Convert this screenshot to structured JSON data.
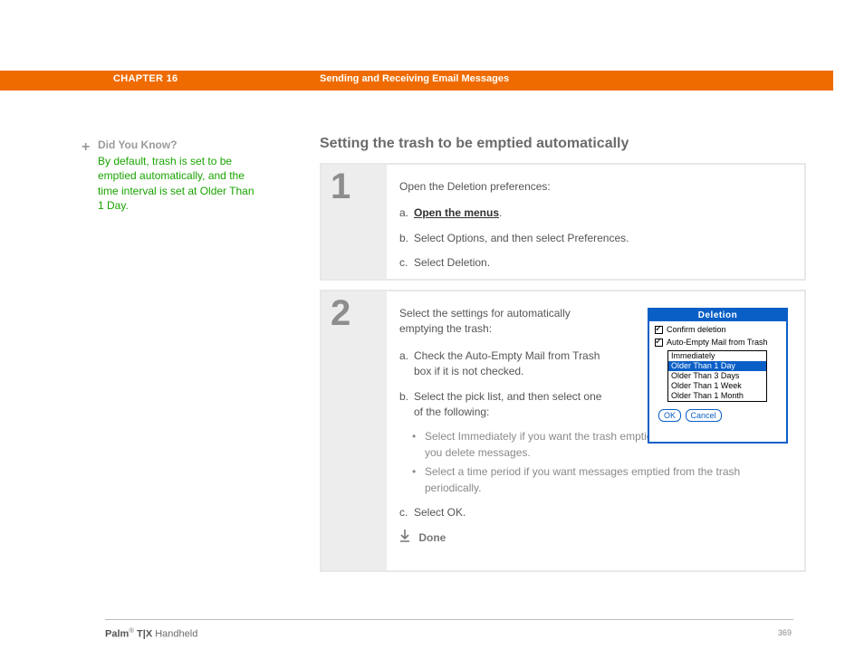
{
  "header": {
    "chapter": "CHAPTER 16",
    "banner": "Sending and Receiving Email Messages"
  },
  "sidebar": {
    "dyk_heading": "Did You Know?",
    "dyk_body": "By default, trash is set to be emptied automatically, and the time interval is set at Older Than 1 Day."
  },
  "section_title": "Setting the trash to be emptied automatically",
  "step1": {
    "num": "1",
    "intro": "Open the Deletion preferences:",
    "a_label": "a.",
    "a_text": "Open the menus",
    "a_suffix": ".",
    "b_label": "b.",
    "b_text": "Select Options, and then select Preferences.",
    "c_label": "c.",
    "c_text": "Select Deletion."
  },
  "step2": {
    "num": "2",
    "intro": "Select the settings for automatically emptying the trash:",
    "a_label": "a.",
    "a_text": "Check the Auto-Empty Mail from Trash box if it is not checked.",
    "b_label": "b.",
    "b_text": "Select the pick list, and then select one of the following:",
    "bullet1": "Select Immediately if you want the trash emptied automatically each time you delete messages.",
    "bullet2": "Select a time period if you want messages emptied from the trash periodically.",
    "c_label": "c.",
    "c_text": "Select OK.",
    "done": "Done"
  },
  "palm": {
    "title": "Deletion",
    "chk1": "Confirm deletion",
    "chk2": "Auto-Empty Mail from Trash",
    "options": [
      "Immediately",
      "Older Than 1 Day",
      "Older Than 3 Days",
      "Older Than 1 Week",
      "Older Than 1 Month"
    ],
    "selected_index": 1,
    "ok": "OK",
    "cancel": "Cancel"
  },
  "footer": {
    "brand": "Palm",
    "reg": "®",
    "model": " T|X",
    "suffix": " Handheld",
    "page": "369"
  }
}
